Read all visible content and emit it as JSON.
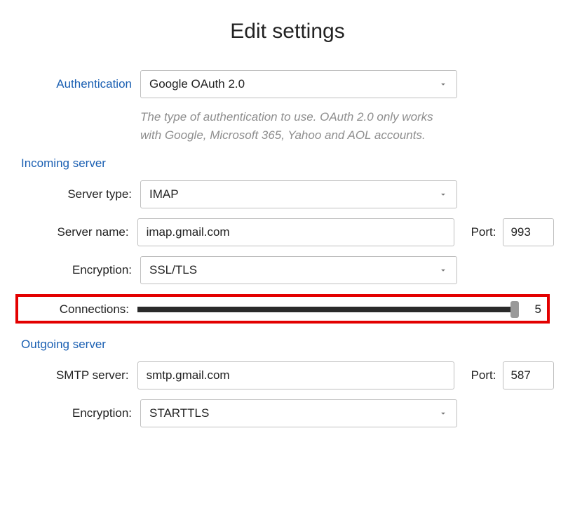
{
  "title": "Edit settings",
  "auth": {
    "label": "Authentication",
    "value": "Google OAuth 2.0",
    "help": "The type of authentication to use. OAuth 2.0 only works with Google, Microsoft 365, Yahoo and AOL accounts."
  },
  "incoming": {
    "heading": "Incoming server",
    "server_type_label": "Server type:",
    "server_type_value": "IMAP",
    "server_name_label": "Server name:",
    "server_name_value": "imap.gmail.com",
    "port_label": "Port:",
    "port_value": "993",
    "encryption_label": "Encryption:",
    "encryption_value": "SSL/TLS",
    "connections_label": "Connections:",
    "connections_value": "5"
  },
  "outgoing": {
    "heading": "Outgoing server",
    "smtp_label": "SMTP server:",
    "smtp_value": "smtp.gmail.com",
    "port_label": "Port:",
    "port_value": "587",
    "encryption_label": "Encryption:",
    "encryption_value": "STARTTLS"
  }
}
